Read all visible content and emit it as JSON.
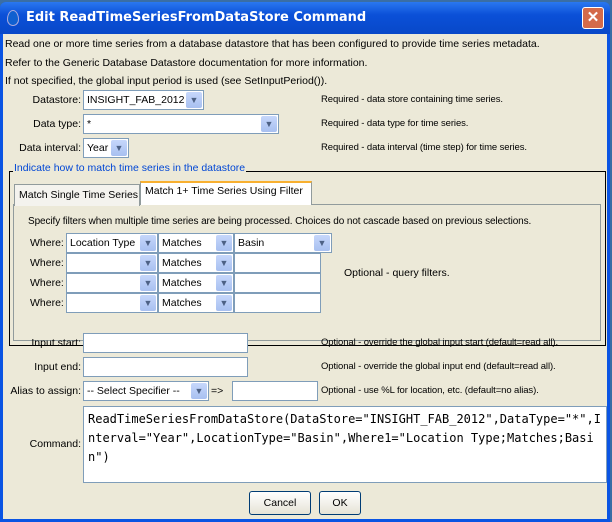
{
  "window": {
    "title": "Edit ReadTimeSeriesFromDataStore Command",
    "close_label": "✕"
  },
  "intro": [
    "Read one or more time series from a database datastore that has been configured to provide time series metadata.",
    "Refer to the Generic Database Datastore documentation for more information.",
    "If not specified, the global input period is used (see SetInputPeriod())."
  ],
  "datastore": {
    "label": "Datastore:",
    "value": "INSIGHT_FAB_2012",
    "note": "Required - data store containing time series."
  },
  "datatype": {
    "label": "Data type:",
    "value": "*",
    "note": "Required - data type for time series."
  },
  "interval": {
    "label": "Data interval:",
    "value": "Year",
    "note": "Required - data interval (time step) for time series."
  },
  "group": {
    "legend": "Indicate how to match time series in the datastore",
    "tabs": [
      {
        "label": "Match Single Time Series"
      },
      {
        "label": "Match 1+ Time Series Using Filter",
        "selected": true
      }
    ],
    "filter_help": "Specify filters when multiple time series are being processed.  Choices do not cascade based on previous selections.",
    "filters": [
      {
        "label": "Where:",
        "field": "Location Type",
        "op": "Matches",
        "value": "Basin"
      },
      {
        "label": "Where:",
        "field": "",
        "op": "Matches",
        "value": ""
      },
      {
        "label": "Where:",
        "field": "",
        "op": "Matches",
        "value": ""
      },
      {
        "label": "Where:",
        "field": "",
        "op": "Matches",
        "value": ""
      }
    ],
    "filter_note": "Optional - query filters."
  },
  "input_start": {
    "label": "Input start:",
    "value": "",
    "note": "Optional - override the global input start (default=read all)."
  },
  "input_end": {
    "label": "Input end:",
    "value": "",
    "note": "Optional - override the global input end (default=read all)."
  },
  "alias": {
    "label": "Alias to assign:",
    "specifier": "-- Select Specifier --",
    "arrow": "=>",
    "value": "",
    "note": "Optional - use %L for location, etc. (default=no alias)."
  },
  "command": {
    "label": "Command:",
    "text": "ReadTimeSeriesFromDataStore(DataStore=\"INSIGHT_FAB_2012\",DataType=\"*\",Interval=\"Year\",LocationType=\"Basin\",Where1=\"Location Type;Matches;Basin\")"
  },
  "buttons": {
    "cancel": "Cancel",
    "ok": "OK"
  }
}
